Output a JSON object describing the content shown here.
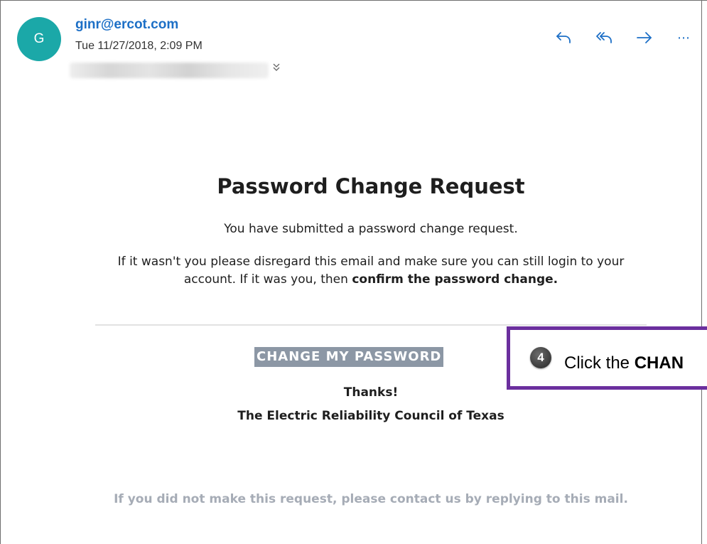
{
  "header": {
    "avatar_initial": "G",
    "sender": "ginr@ercot.com",
    "date": "Tue 11/27/2018, 2:09 PM",
    "actions": [
      {
        "name": "reply",
        "icon": "reply-icon"
      },
      {
        "name": "reply-all",
        "icon": "reply-all-icon"
      },
      {
        "name": "forward",
        "icon": "forward-icon"
      },
      {
        "name": "more",
        "icon": "more-icon",
        "glyph": "⋯"
      }
    ],
    "expand_icon": "chevron-double-down-icon"
  },
  "email": {
    "title": "Password Change Request",
    "p1": "You have submitted a password change request.",
    "p2_plain": "If it wasn't you please disregard this email and make sure you can still login to your account. If it was you, then ",
    "p2_bold": "confirm the password change.",
    "cta": "CHANGE MY PASSWORD",
    "thanks": "Thanks!",
    "org": "The Electric Reliability Council of Texas",
    "footer": "If you did not make this request, please contact us by replying to this mail."
  },
  "callout": {
    "step": "4",
    "text_plain": "Click the ",
    "text_bold": "CHAN"
  },
  "colors": {
    "avatar": "#1ba8a8",
    "link_blue": "#1c6fc6",
    "cta_bg": "#8c97a5",
    "callout_border": "#6b2f9e",
    "footer_text": "#a6acb6"
  }
}
